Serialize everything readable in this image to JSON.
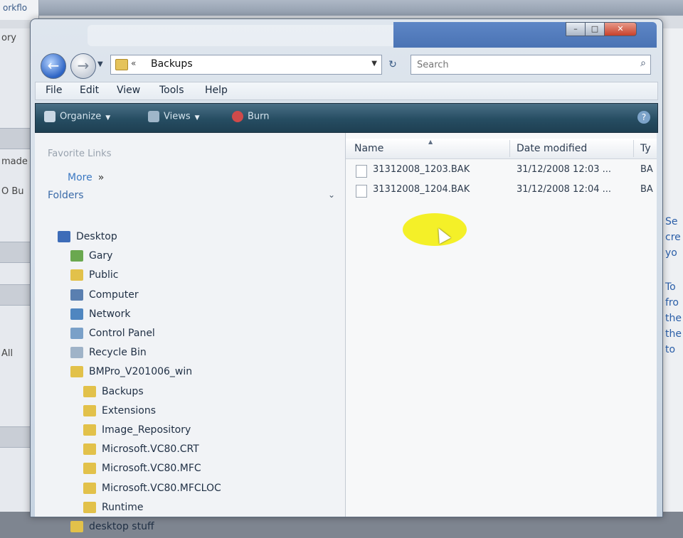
{
  "background_app": {
    "left_tab": "orkflo",
    "left_fragments": [
      "ory",
      "made",
      "O Bu",
      "All"
    ],
    "right_fragments": [
      "Se",
      "cre",
      "yo",
      "To",
      "fro",
      "the",
      "the",
      "to"
    ]
  },
  "window": {
    "address": {
      "breadcrumb": "Backups",
      "chevron": "«"
    },
    "search": {
      "placeholder": "Search"
    },
    "menu": [
      "File",
      "Edit",
      "View",
      "Tools",
      "Help"
    ],
    "toolbar": {
      "organize": "Organize",
      "views": "Views",
      "burn": "Burn",
      "help_glyph": "?"
    },
    "nav": {
      "favorite_links": "Favorite Links",
      "more": "More",
      "more_glyph": "»",
      "folders": "Folders",
      "tree": [
        {
          "label": "Desktop",
          "icon": "desktop-icon",
          "level": 0,
          "color": "#3d6cb8"
        },
        {
          "label": "Gary",
          "icon": "user-folder-icon",
          "level": 1,
          "color": "#6aa84f"
        },
        {
          "label": "Public",
          "icon": "folder-icon",
          "level": 1,
          "color": "#e2c14a"
        },
        {
          "label": "Computer",
          "icon": "computer-icon",
          "level": 1,
          "color": "#5a7fb0"
        },
        {
          "label": "Network",
          "icon": "network-icon",
          "level": 1,
          "color": "#4f86c0"
        },
        {
          "label": "Control Panel",
          "icon": "control-panel-icon",
          "level": 1,
          "color": "#7aa0c8"
        },
        {
          "label": "Recycle Bin",
          "icon": "recycle-bin-icon",
          "level": 1,
          "color": "#9fb3c8"
        },
        {
          "label": "BMPro_V201006_win",
          "icon": "folder-icon",
          "level": 1,
          "color": "#e2c14a"
        },
        {
          "label": "Backups",
          "icon": "folder-icon",
          "level": 2,
          "color": "#e2c14a"
        },
        {
          "label": "Extensions",
          "icon": "folder-icon",
          "level": 2,
          "color": "#e2c14a"
        },
        {
          "label": "Image_Repository",
          "icon": "folder-icon",
          "level": 2,
          "color": "#e2c14a"
        },
        {
          "label": "Microsoft.VC80.CRT",
          "icon": "folder-icon",
          "level": 2,
          "color": "#e2c14a"
        },
        {
          "label": "Microsoft.VC80.MFC",
          "icon": "folder-icon",
          "level": 2,
          "color": "#e2c14a"
        },
        {
          "label": "Microsoft.VC80.MFCLOC",
          "icon": "folder-icon",
          "level": 2,
          "color": "#e2c14a"
        },
        {
          "label": "Runtime",
          "icon": "folder-icon",
          "level": 2,
          "color": "#e2c14a"
        },
        {
          "label": "desktop stuff",
          "icon": "folder-icon",
          "level": 1,
          "color": "#e2c14a"
        }
      ]
    },
    "files": {
      "columns": [
        "Name",
        "Date modified",
        "Ty"
      ],
      "rows": [
        {
          "name": "31312008_1203.BAK",
          "date": "31/12/2008 12:03 ...",
          "type": "BA"
        },
        {
          "name": "31312008_1204.BAK",
          "date": "31/12/2008 12:04 ...",
          "type": "BA"
        }
      ]
    }
  }
}
